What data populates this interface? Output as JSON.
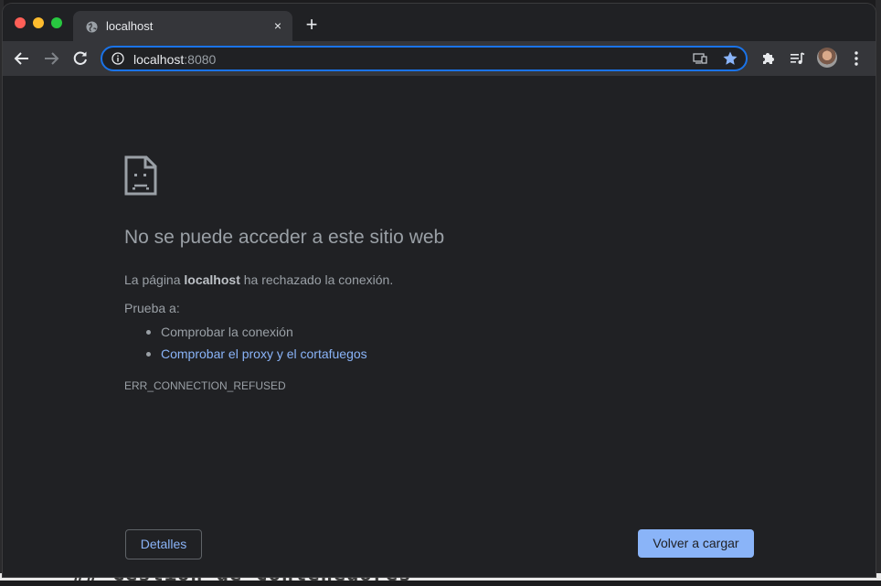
{
  "browser": {
    "tab_title": "localhost",
    "new_tab_label": "+",
    "tab_close_label": "×",
    "url_host": "localhost",
    "url_port": ":8080",
    "accent": "#8ab4f8"
  },
  "error_page": {
    "headline": "No se puede acceder a este sitio web",
    "desc_prefix": "La página ",
    "desc_host": "localhost",
    "desc_suffix": " ha rechazado la conexión.",
    "try_label": "Prueba a:",
    "suggestions": [
      "Comprobar la conexión",
      "Comprobar el proxy y el cortafuegos"
    ],
    "error_code": "ERR_CONNECTION_REFUSED",
    "details_label": "Detalles",
    "reload_label": "Volver a cargar"
  },
  "background_window": {
    "partial_text": "## Gestion de Contenedores"
  }
}
